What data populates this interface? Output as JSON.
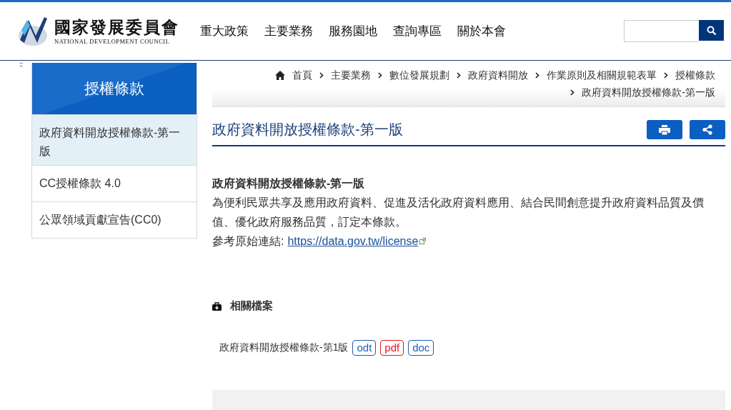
{
  "header": {
    "logo": {
      "title": "國家發展委員會",
      "subtitle": "NATIONAL DEVELOPMENT COUNCIL"
    },
    "nav": [
      "重大政策",
      "主要業務",
      "服務園地",
      "查詢專區",
      "關於本會"
    ]
  },
  "sidebar": {
    "accesskey": ":::",
    "title": "授權條款",
    "items": [
      {
        "label": "政府資料開放授權條款-第一版",
        "selected": true
      },
      {
        "label": "CC授權條款 4.0",
        "selected": false
      },
      {
        "label": "公眾領域貢獻宣告(CC0)",
        "selected": false
      }
    ]
  },
  "breadcrumb": [
    "首頁",
    "主要業務",
    "數位發展規劃",
    "政府資料開放",
    "作業原則及相關規範表單",
    "授權條款",
    "政府資料開放授權條款-第一版"
  ],
  "page": {
    "title": "政府資料開放授權條款-第一版",
    "body": {
      "heading": "政府資料開放授權條款-第一版",
      "text": "為便利民眾共享及應用政府資料、促進及活化政府資料應用、結合民間創意提升政府資料品質及價值、優化政府服務品質，訂定本條款。",
      "link_label": "參考原始連結:",
      "link": "https://data.gov.tw/license"
    },
    "files": {
      "title": "相關檔案",
      "items": [
        {
          "name": "政府資料開放授權條款-第1版",
          "formats": [
            {
              "label": "odt",
              "color": "#1f5fb4"
            },
            {
              "label": "pdf",
              "color": "#e8141c"
            },
            {
              "label": "doc",
              "color": "#1f5fb4"
            }
          ]
        }
      ]
    }
  }
}
